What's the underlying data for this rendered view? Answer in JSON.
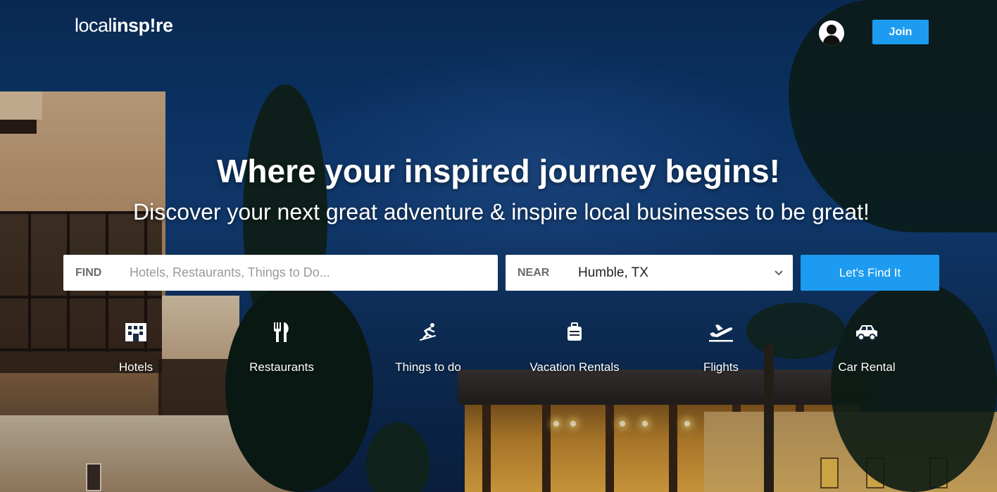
{
  "header": {
    "logo": {
      "prefix": "local",
      "brand": "insp!re"
    },
    "join_label": "Join"
  },
  "hero": {
    "headline": "Where your inspired journey begins!",
    "subheadline": "Discover your next great adventure & inspire local businesses to be great!"
  },
  "search": {
    "find_label": "FIND",
    "find_placeholder": "Hotels, Restaurants, Things to Do...",
    "near_label": "NEAR",
    "near_value": "Humble, TX",
    "submit_label": "Let's Find It"
  },
  "categories": [
    {
      "label": "Hotels",
      "icon": "hotel-icon"
    },
    {
      "label": "Restaurants",
      "icon": "fork-knife-icon"
    },
    {
      "label": "Things to do",
      "icon": "skater-icon"
    },
    {
      "label": "Vacation Rentals",
      "icon": "suitcase-icon"
    },
    {
      "label": "Flights",
      "icon": "airplane-icon"
    },
    {
      "label": "Car Rental",
      "icon": "car-icon"
    }
  ],
  "colors": {
    "accent": "#1d9bf0",
    "sky": "#0d3a72"
  }
}
